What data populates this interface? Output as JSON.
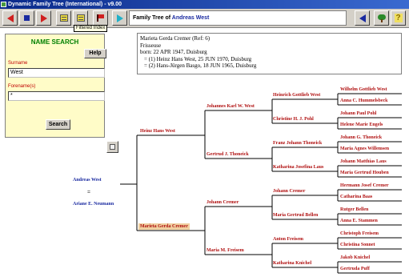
{
  "window": {
    "title": "Dynamic Family Tree (International) - v9.00"
  },
  "toolbar": {
    "tooltip": "Filtered Index"
  },
  "tree_title": {
    "prefix": "Family Tree of",
    "person": "Andreas West"
  },
  "name_search": {
    "title": "NAME SEARCH",
    "help_label": "Help",
    "surname_label": "Surname",
    "surname_value": "West",
    "forenames_label": "Forename(s)",
    "forenames_value": "*",
    "search_label": "Search"
  },
  "details": {
    "lines": [
      "Marieta Gerda Cremer     (Ref: 6)",
      "Frisseuse",
      "born: 22 APR 1947, Duisburg",
      "= (1) Heinz Hans West, 25 JUN 1970, Duisburg",
      "= (2) Hans-Jürgen Basgo, 18 JUN 1965, Duisburg"
    ]
  },
  "tree": {
    "root": "Andreas West",
    "and_sign": "=",
    "spouse": "Ariane E. Neumann",
    "gen1": [
      "Heinz Hans West",
      "Marieta Gerda Cremer"
    ],
    "gen2": [
      "Johannes Karl W. West",
      "Gertrud J. Thoneick",
      "Johann Cremer",
      "Maria M. Freisem"
    ],
    "gen3": [
      "Heinrich Gottlieb West",
      "Christine H. J. Pohl",
      "Franz Johann Thoneick",
      "Katharina Josefina Laus",
      "Johann Cremer",
      "Maria Gertrud Bellen",
      "Anton Freisem",
      "Katharina Knichel"
    ],
    "gen4": [
      "Wilhelm Gottlieb West",
      "Anna C. Hummelsbeck",
      "Johann Paul Pohl",
      "Helene Marie Engels",
      "Johann G. Thoneick",
      "Maria Agnes Willemsen",
      "Johann Matthias Laus",
      "Maria Gertrud Houben",
      "Hermann Josef Cremer",
      "Catharina Baas",
      "Rutger Bellen",
      "Anna E. Stammen",
      "Christoph Freisem",
      "Christina Sonnet",
      "Jakob Knichel",
      "Gertruda Puff"
    ]
  }
}
